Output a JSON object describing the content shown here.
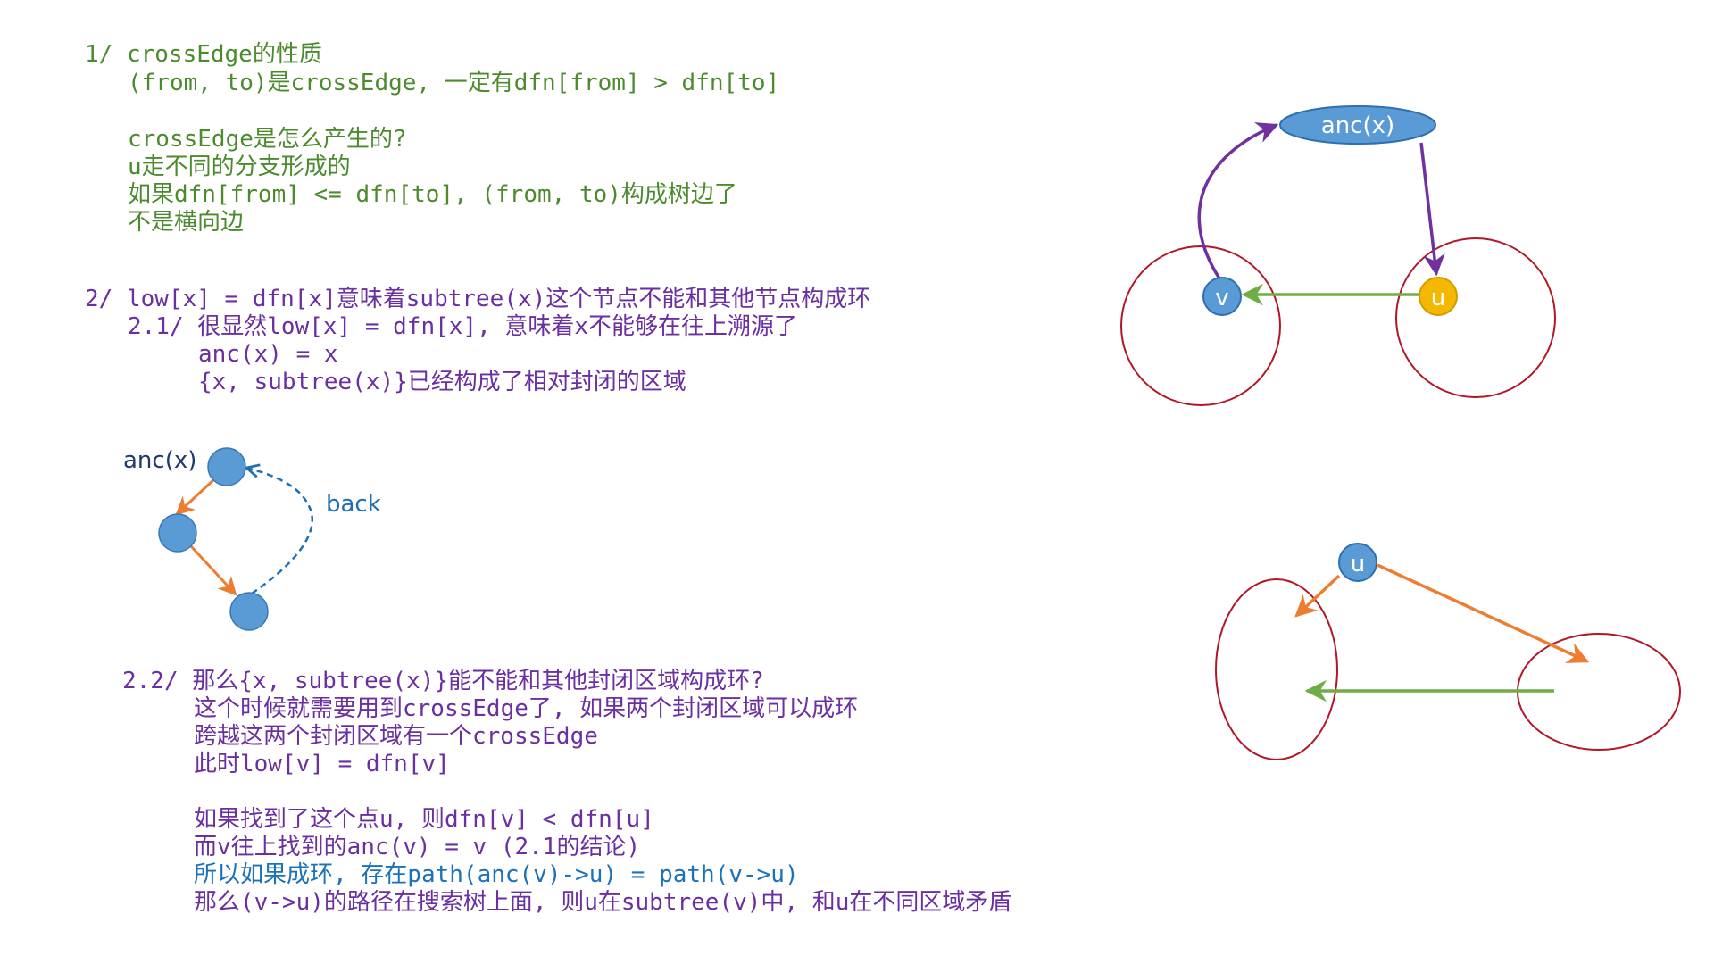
{
  "section1": {
    "l1": "1/ crossEdge的性质",
    "l2": "(from, to)是crossEdge, 一定有dfn[from] > dfn[to]",
    "l3": "crossEdge是怎么产生的?",
    "l4": "u走不同的分支形成的",
    "l5": "如果dfn[from] <= dfn[to], (from, to)构成树边了",
    "l6": "不是横向边"
  },
  "section2": {
    "l1": "2/ low[x] = dfn[x]意味着subtree(x)这个节点不能和其他节点构成环",
    "l2": "2.1/ 很显然low[x] = dfn[x], 意味着x不能够在往上溯源了",
    "l3": "anc(x) = x",
    "l4": "{x, subtree(x)}已经构成了相对封闭的区域"
  },
  "section22": {
    "l1": "2.2/ 那么{x, subtree(x)}能不能和其他封闭区域构成环?",
    "l2": "这个时候就需要用到crossEdge了, 如果两个封闭区域可以成环",
    "l3": "跨越这两个封闭区域有一个crossEdge",
    "l4": "此时low[v] = dfn[v]",
    "l5": "如果找到了这个点u, 则dfn[v] < dfn[u]",
    "l6": "而v往上找到的anc(v) = v (2.1的结论)",
    "l7": "所以如果成环, 存在path(anc(v)->u) = path(v->u)",
    "l8": "那么(v->u)的路径在搜索树上面, 则u在subtree(v)中, 和u在不同区域矛盾"
  },
  "diagram_left": {
    "anc_label": "anc(x)",
    "back_label": "back"
  },
  "diagram_top_right": {
    "anc_label": "anc(x)",
    "v_label": "v",
    "u_label": "u"
  },
  "diagram_bottom_right": {
    "u_label": "u"
  },
  "colors": {
    "green_text": "#4c8a2e",
    "purple_text": "#6a2fa0",
    "blue_text": "#1a72b8",
    "node_blue": "#5b9bd5",
    "node_yellow": "#f5b800",
    "region_red": "#b0182a",
    "arrow_orange": "#ed7d31",
    "arrow_green": "#70ad47",
    "arrow_purple": "#7030a0",
    "back_blue": "#1f6fb5"
  }
}
